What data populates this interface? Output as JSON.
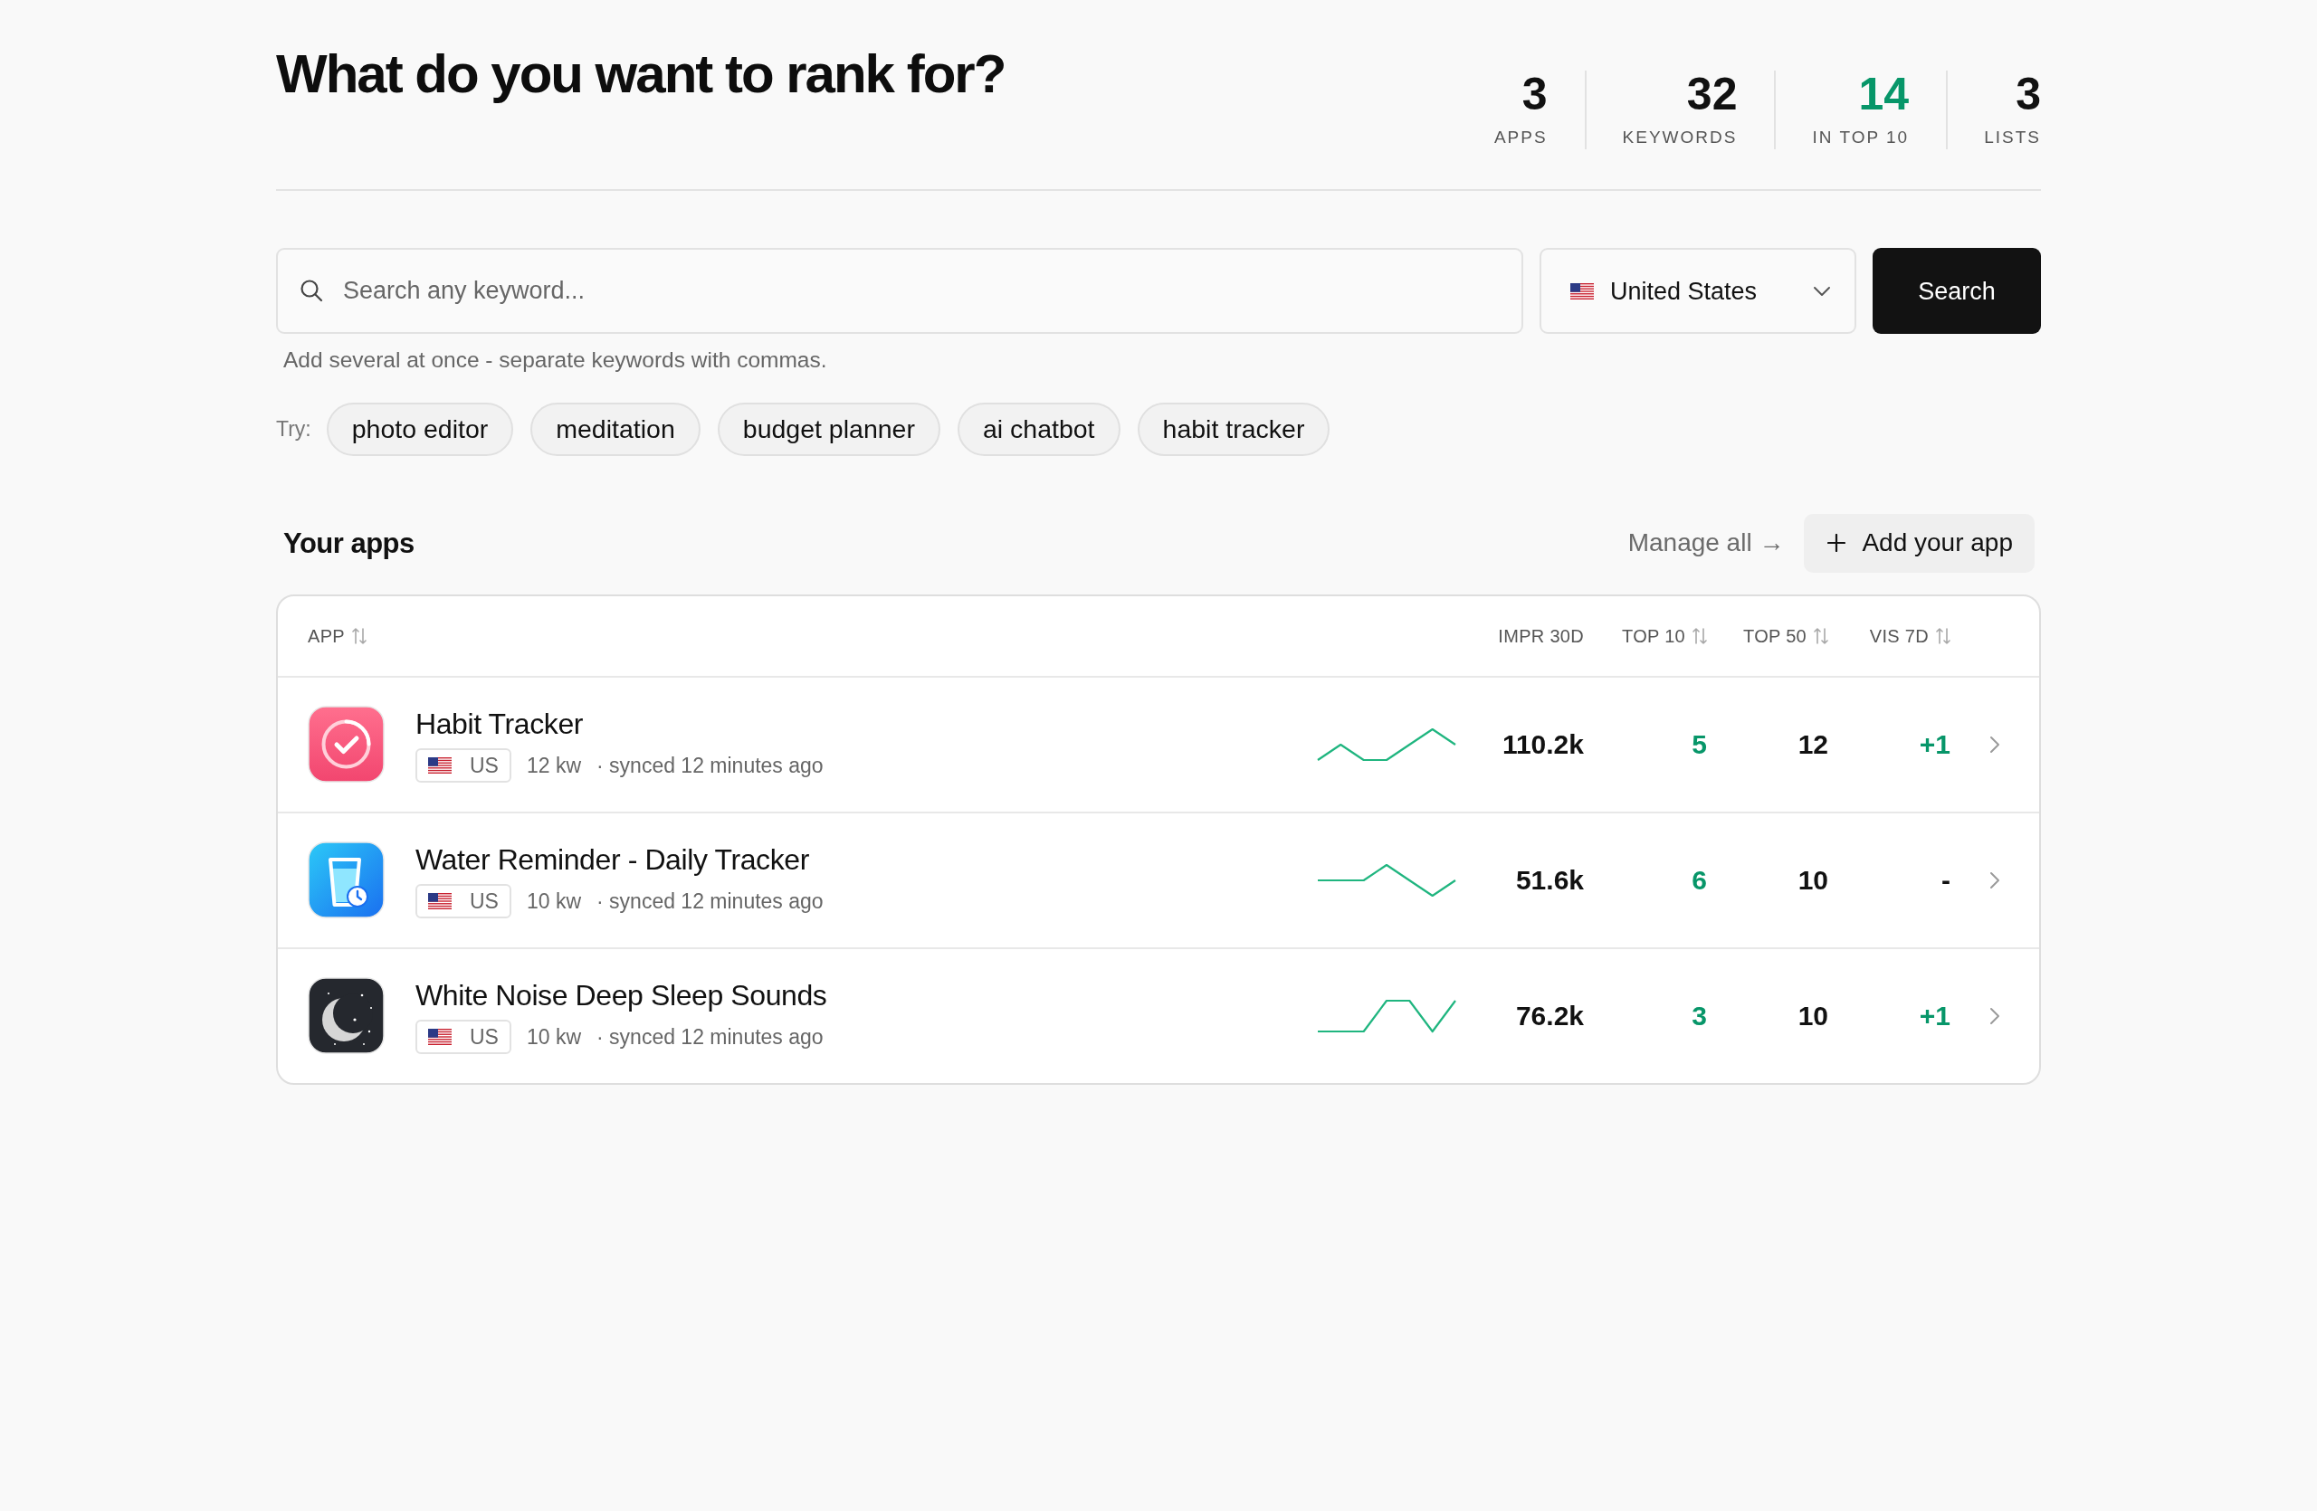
{
  "header": {
    "title": "What do you want to rank for?",
    "stats": [
      {
        "value": "3",
        "label": "APPS",
        "highlight": false
      },
      {
        "value": "32",
        "label": "KEYWORDS",
        "highlight": false
      },
      {
        "value": "14",
        "label": "IN TOP 10",
        "highlight": true
      },
      {
        "value": "3",
        "label": "LISTS",
        "highlight": false
      }
    ]
  },
  "search": {
    "placeholder": "Search any keyword...",
    "country": "United States",
    "button": "Search",
    "hint": "Add several at once - separate keywords with commas."
  },
  "suggestions": {
    "label": "Try:",
    "chips": [
      "photo editor",
      "meditation",
      "budget planner",
      "ai chatbot",
      "habit tracker"
    ]
  },
  "apps_section": {
    "title": "Your apps",
    "manage_link": "Manage all →",
    "add_button": "Add your app"
  },
  "table": {
    "columns": [
      {
        "label": "APP",
        "sortable": true
      },
      {
        "label": "IMPR 30D",
        "sortable": false
      },
      {
        "label": "TOP 10",
        "sortable": true
      },
      {
        "label": "TOP 50",
        "sortable": true
      },
      {
        "label": "VIS 7D",
        "sortable": true
      }
    ],
    "rows": [
      {
        "kind": "checkmark",
        "name": "Habit Tracker",
        "country": "US",
        "keywords": "12 kw",
        "synced": "· synced 12 minutes ago",
        "impr_30d": "110.2k",
        "top_10": "5",
        "top_50": "12",
        "vis_7d": "+1",
        "vis_positive": true
      },
      {
        "kind": "glass",
        "name": "Water Reminder - Daily Tracker",
        "country": "US",
        "keywords": "10 kw",
        "synced": "· synced 12 minutes ago",
        "impr_30d": "51.6k",
        "top_10": "6",
        "top_50": "10",
        "vis_7d": "-",
        "vis_positive": false
      },
      {
        "kind": "moon",
        "name": "White Noise Deep Sleep Sounds",
        "country": "US",
        "keywords": "10 kw",
        "synced": "· synced 12 minutes ago",
        "impr_30d": "76.2k",
        "top_10": "3",
        "top_50": "10",
        "vis_7d": "+1",
        "vis_positive": true
      }
    ]
  }
}
